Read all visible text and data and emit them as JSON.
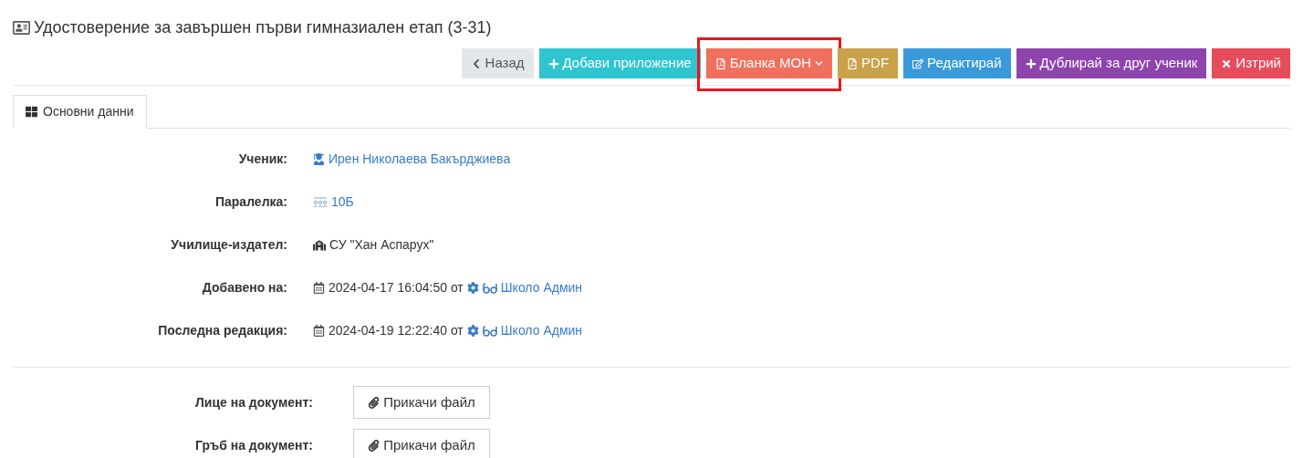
{
  "title": "Удостоверение за завършен първи гимназиален етап (3-31)",
  "actions": [
    {
      "kind": "back",
      "label": "Назад",
      "highlighted": false
    },
    {
      "kind": "add",
      "label": "Добави приложение",
      "highlighted": false
    },
    {
      "kind": "blank",
      "label": "Бланка МОН",
      "highlighted": true
    },
    {
      "kind": "pdf",
      "label": "PDF",
      "highlighted": false
    },
    {
      "kind": "edit",
      "label": "Редактирай",
      "highlighted": false
    },
    {
      "kind": "duplicate",
      "label": "Дублирай за друг ученик",
      "highlighted": false
    },
    {
      "kind": "delete",
      "label": "Изтрий",
      "highlighted": false
    }
  ],
  "tabs": [
    {
      "label": "Основни данни",
      "selected": true
    }
  ],
  "fields": [
    {
      "kind": "student",
      "label": "Ученик:",
      "value": "Ирен Николаева Бакърджиева"
    },
    {
      "kind": "class",
      "label": "Паралелка:",
      "value": "10Б"
    },
    {
      "kind": "school",
      "label": "Училище-издател:",
      "value": "СУ \"Хан Аспарух\""
    },
    {
      "kind": "audit",
      "label": "Добавено на:",
      "date": "2024-04-17 16:04:50 от",
      "user": "Школо Админ"
    },
    {
      "kind": "audit",
      "label": "Последна редакция:",
      "date": "2024-04-19 12:22:40 от",
      "user": "Школо Админ"
    }
  ],
  "attachments": [
    {
      "label": "Лице на документ:",
      "button": "Прикачи файл"
    },
    {
      "label": "Гръб на документ:",
      "button": "Прикачи файл"
    }
  ]
}
